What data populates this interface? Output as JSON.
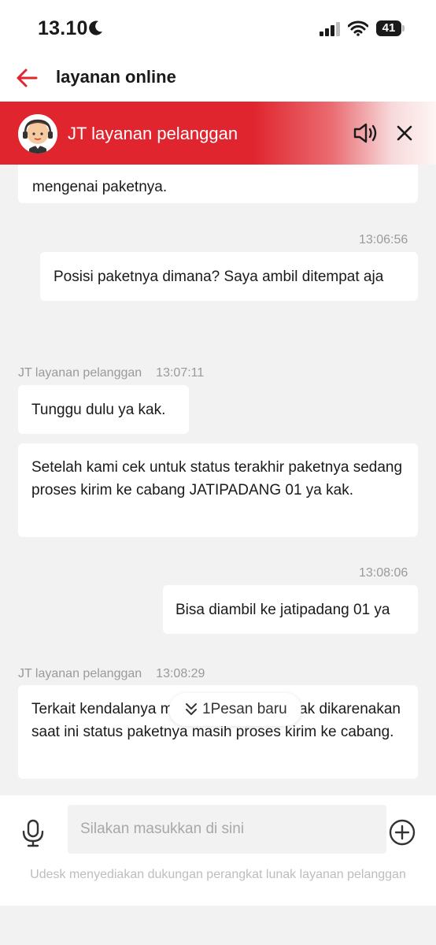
{
  "status_bar": {
    "time": "13.10",
    "battery": "41"
  },
  "header": {
    "title": "layanan online"
  },
  "agent_banner": {
    "name": "JT layanan pelanggan"
  },
  "messages": [
    {
      "from": "agent",
      "text": "mengenai paketnya."
    },
    {
      "from": "user",
      "time": "13:06:56",
      "text": "Posisi paketnya dimana? Saya ambil ditempat aja"
    },
    {
      "from": "agent",
      "sender": "JT layanan pelanggan",
      "time": "13:07:11",
      "text": "Tunggu dulu ya kak."
    },
    {
      "from": "agent",
      "text": "Setelah kami cek untuk status terakhir paketnya sedang proses kirim ke cabang JATIPADANG 01 ya kak."
    },
    {
      "from": "user",
      "time": "13:08:06",
      "text": "Bisa diambil ke jatipadang 01 ya"
    },
    {
      "from": "agent",
      "sender": "JT layanan pelanggan",
      "time": "13:08:29",
      "text": "Terkait kendalanya mohon ditunggu ya kak dikarenakan saat ini status paketnya masih proses kirim ke cabang."
    }
  ],
  "new_message_pill": {
    "label": "1Pesan baru"
  },
  "input": {
    "placeholder": "Silakan masukkan di sini"
  },
  "footer_note": "Udesk menyediakan dukungan perangkat lunak layanan pelanggan",
  "colors": {
    "brand_red": "#e0252e",
    "chat_bg": "#f2f2f2",
    "bubble_bg": "#ffffff",
    "muted_text": "#9a9a9a"
  },
  "icons": [
    "moon-icon",
    "signal-icon",
    "wifi-icon",
    "battery-icon",
    "back-arrow-icon",
    "agent-avatar-icon",
    "speaker-icon",
    "close-icon",
    "double-chevron-down-icon",
    "mic-icon",
    "plus-circle-icon"
  ]
}
